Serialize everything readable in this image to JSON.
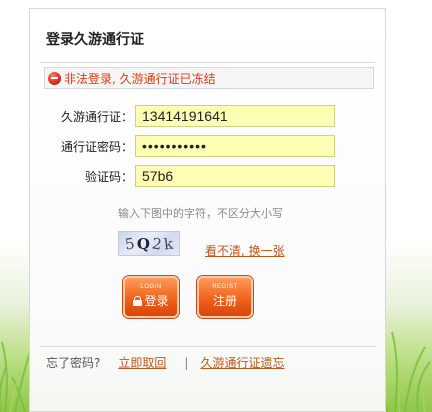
{
  "header": {
    "title": "登录久游通行证"
  },
  "alert": {
    "message": "非法登录, 久游通行证已冻结",
    "icon": "stop-icon",
    "color": "#e03a12"
  },
  "form": {
    "account": {
      "label": "久游通行证：",
      "value": "13414191641"
    },
    "password": {
      "label": "通行证密码：",
      "value": "•••••••••••"
    },
    "captcha": {
      "label": "验证码：",
      "value": "57b6"
    }
  },
  "captcha_area": {
    "hint": "输入下图中的字符，不区分大小写",
    "image_chars": [
      "5",
      "Q",
      "2",
      "k"
    ],
    "refresh_label": "看不清, 换一张"
  },
  "buttons": {
    "login": {
      "small": "LOGIN",
      "label": "登录"
    },
    "register": {
      "small": "REGIST",
      "label": "注册"
    }
  },
  "footer": {
    "forgot_question": "忘了密码?",
    "retrieve_link": "立即取回",
    "separator": "|",
    "forgot_account_link": "久游通行证遗忘"
  },
  "colors": {
    "accent": "#c0571c",
    "field_bg": "#fdfdb4",
    "button": "#f0621a"
  }
}
